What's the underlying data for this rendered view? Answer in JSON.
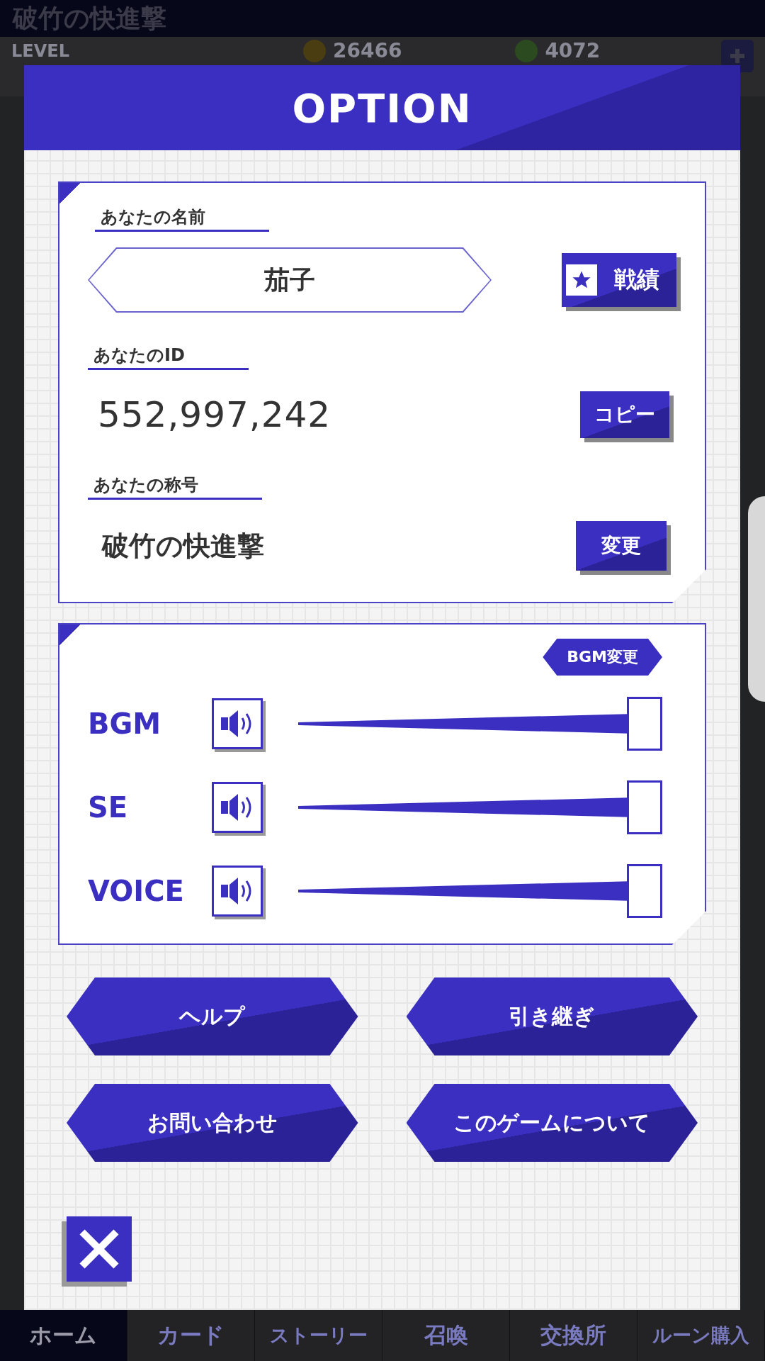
{
  "header": {
    "title": "破竹の快進撃",
    "level_label": "LEVEL",
    "coins": "26466",
    "gems": "4072"
  },
  "dialog": {
    "title": "OPTION",
    "profile": {
      "name_label": "あなたの名前",
      "name": "茄子",
      "record_button": "戦績",
      "id_label": "あなたのID",
      "id": "552,997,242",
      "copy_button": "コピー",
      "title_label": "あなたの称号",
      "player_title": "破竹の快進撃",
      "change_button": "変更"
    },
    "sound": {
      "bgm_change_button": "BGM変更",
      "channels": [
        {
          "name": "BGM",
          "muted": false,
          "level": 1
        },
        {
          "name": "SE",
          "muted": false,
          "level": 1
        },
        {
          "name": "VOICE",
          "muted": false,
          "level": 1
        }
      ]
    },
    "buttons": [
      "ヘルプ",
      "引き継ぎ",
      "お問い合わせ",
      "このゲームについて"
    ]
  },
  "nav": [
    {
      "label": "ホーム",
      "selected": true
    },
    {
      "label": "カード",
      "selected": false
    },
    {
      "label": "ストーリー",
      "selected": false
    },
    {
      "label": "召喚",
      "selected": false
    },
    {
      "label": "交換所",
      "selected": false
    },
    {
      "label": "ルーン購入",
      "selected": false
    }
  ]
}
